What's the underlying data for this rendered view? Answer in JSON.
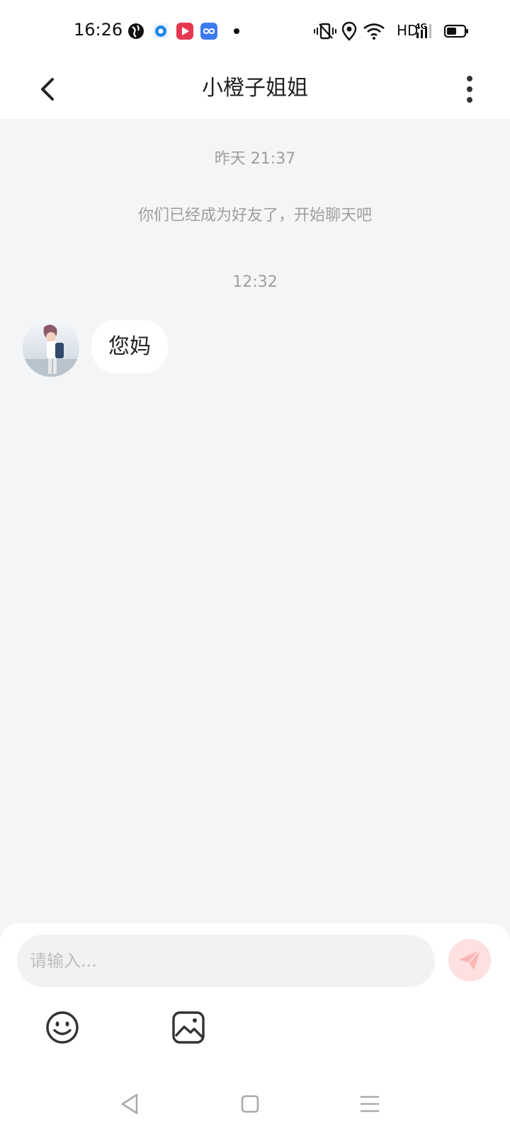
{
  "status": {
    "time": "16:26",
    "network": "HD",
    "icons": [
      "app-globe-icon",
      "app-blue-circle-icon",
      "app-red-play-icon",
      "app-blue-infinity-icon",
      "notification-dot-icon",
      "vibrate-icon",
      "location-icon",
      "wifi-icon",
      "signal-4g-icon",
      "battery-icon"
    ]
  },
  "header": {
    "title": "小橙子姐姐",
    "back_icon": "chevron-left-icon",
    "more_icon": "more-vertical-icon"
  },
  "chat": {
    "timestamp_1": "昨天 21:37",
    "system_message": "你们已经成为好友了，开始聊天吧",
    "timestamp_2": "12:32",
    "messages": [
      {
        "sender": "other",
        "text": "您妈"
      }
    ]
  },
  "composer": {
    "placeholder": "请输入...",
    "send_icon": "paper-plane-icon",
    "tools": [
      "emoji-icon",
      "image-icon"
    ]
  },
  "navbar": {
    "buttons": [
      "back-triangle-icon",
      "home-square-icon",
      "menu-lines-icon"
    ]
  },
  "colors": {
    "background": "#f4f5f7",
    "send_accent": "#fde0df",
    "muted_text": "#9e9e9e"
  }
}
